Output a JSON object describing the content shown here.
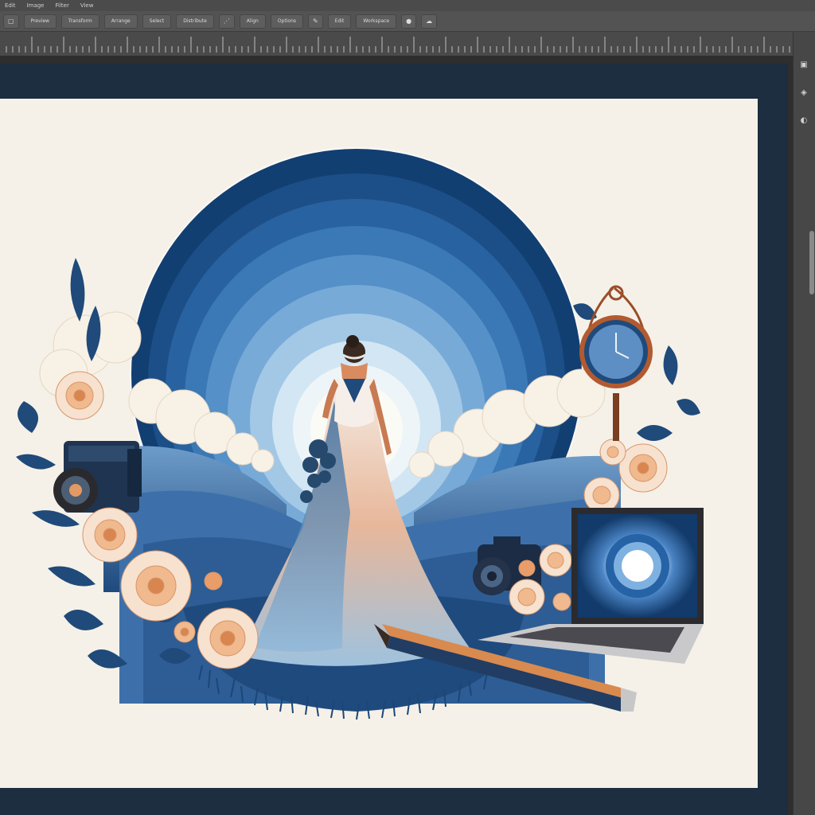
{
  "app": {
    "menu": [
      "Edit",
      "Image",
      "Filter",
      "View"
    ],
    "options": [
      {
        "label": "Preview",
        "icon": "document-icon"
      },
      {
        "label": "Transform"
      },
      {
        "label": "Arrange"
      },
      {
        "label": "Select"
      },
      {
        "label": "Distribute"
      },
      {
        "label": "Align"
      },
      {
        "label": "Options"
      },
      {
        "label": "Edit"
      },
      {
        "label": "Workspace"
      }
    ],
    "right_panel_icons": [
      "layers-icon",
      "properties-icon",
      "adjustments-icon"
    ]
  },
  "colors": {
    "workspace_bg": "#2e2e2e",
    "doc_frame": "#1c2e3f",
    "canvas": "#f5f1e8",
    "accent_blue": "#1e4f86",
    "peach": "#e89968"
  },
  "artwork": {
    "subject": "bride-in-gown",
    "elements": [
      "concentric-blue-circle",
      "hills",
      "clouds",
      "flowers",
      "camera",
      "vintage-camera",
      "laptop",
      "pencil",
      "pendulum-clock"
    ]
  }
}
